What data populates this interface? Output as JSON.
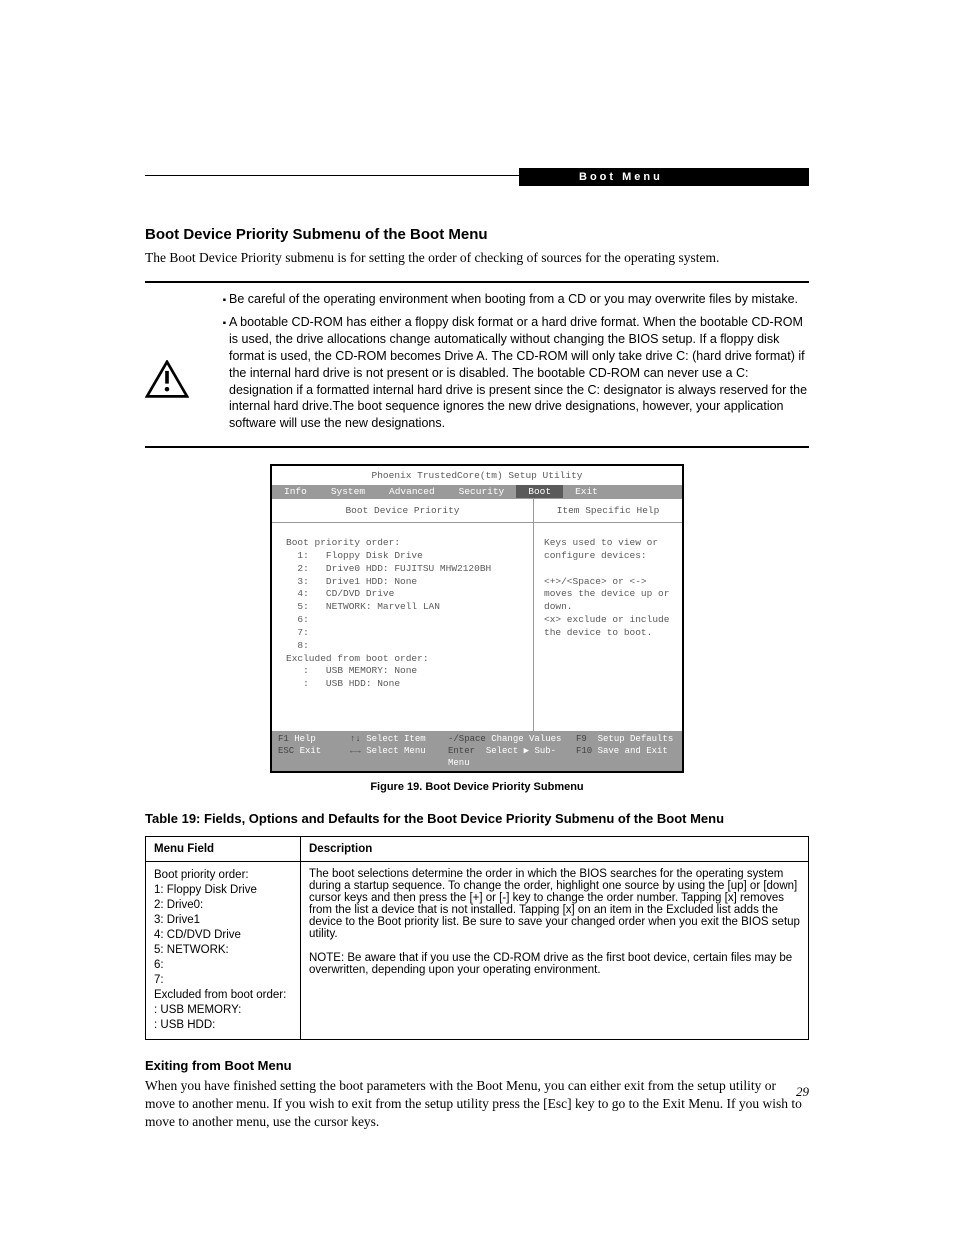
{
  "header": {
    "label": "Boot Menu"
  },
  "section": {
    "title": "Boot Device Priority Submenu of the Boot Menu",
    "intro": "The Boot Device Priority submenu is for setting the order of checking of sources for the operating system."
  },
  "warning": {
    "bullets": [
      "Be careful of the operating environment when booting from a CD or you may overwrite files by mistake.",
      "A bootable CD-ROM has either a floppy disk format or a hard drive format. When the bootable CD-ROM is used, the drive allocations change automatically without changing the BIOS setup. If a floppy disk format is used, the CD-ROM becomes Drive A. The CD-ROM will only take drive C: (hard drive format) if the internal hard drive is not present or is disabled. The bootable CD-ROM can never use a C: designation if a formatted internal hard drive is present since the C: designator is always reserved for the internal hard drive.The boot sequence ignores the new drive designations, however, your application software will use the new designations."
    ]
  },
  "bios": {
    "title": "Phoenix TrustedCore(tm) Setup Utility",
    "tabs": [
      "Info",
      "System",
      "Advanced",
      "Security",
      "Boot",
      "Exit"
    ],
    "active_tab": "Boot",
    "left_header": "Boot Device Priority",
    "right_header": "Item Specific Help",
    "priority_label": "Boot priority order:",
    "priority": [
      "1:   Floppy Disk Drive",
      "2:   Drive0 HDD: FUJITSU MHW2120BH",
      "3:   Drive1 HDD: None",
      "4:   CD/DVD Drive",
      "5:   NETWORK: Marvell LAN",
      "6:",
      "7:",
      "8:"
    ],
    "excluded_label": "Excluded from boot order:",
    "excluded": [
      " :   USB MEMORY: None",
      " :   USB HDD: None"
    ],
    "help_lines": [
      "Keys used to view or",
      "configure devices:",
      "",
      "<+>/<Space> or <->",
      "moves the device up or",
      "down.",
      "<x> exclude or include",
      "the device to boot."
    ],
    "footer": {
      "row1": {
        "c1k": "F1",
        "c1l": "Help",
        "c2k": "↑↓",
        "c2l": "Select Item",
        "c3k": "-/Space",
        "c3l": "Change Values",
        "c4k": "F9",
        "c4l": "Setup Defaults"
      },
      "row2": {
        "c1k": "ESC",
        "c1l": "Exit",
        "c2k": "←→",
        "c2l": "Select Menu",
        "c3k": "Enter",
        "c3l": "Select ▶ Sub-Menu",
        "c4k": "F10",
        "c4l": "Save and Exit"
      }
    }
  },
  "figure_caption": "Figure 19.  Boot Device Priority Submenu",
  "table": {
    "caption": "Table 19: Fields, Options and Defaults for the Boot Device Priority Submenu of the Boot Menu",
    "headers": [
      "Menu Field",
      "Description"
    ],
    "row": {
      "field_lines": [
        "Boot priority order:",
        " 1: Floppy Disk Drive",
        " 2: Drive0:",
        " 3: Drive1",
        " 4: CD/DVD Drive",
        " 5: NETWORK:",
        " 6:",
        " 7:",
        "Excluded from boot order:",
        "   : USB MEMORY:",
        "   : USB HDD:"
      ],
      "desc_p1": "The boot selections determine the order in which the BIOS searches for the operating system during a startup sequence. To change the order, highlight one source by using the [up] or [down] cursor keys and then press the [+] or [-] key to change the order number. Tapping [x] removes from the list a device that is not installed. Tapping [x] on an item in the Excluded list adds the device to the Boot priority list. Be sure to save your changed order when you exit the BIOS setup utility.",
      "desc_p2": "NOTE: Be aware that if you use the CD-ROM drive as the first boot device, certain files may be overwritten, depending upon your operating environment."
    }
  },
  "exit": {
    "title": "Exiting from Boot Menu",
    "body": "When you have finished setting the boot parameters with the Boot Menu, you can either exit from the setup utility or move to another menu. If you wish to exit from the setup utility press the [Esc] key to go to the Exit Menu. If you wish to move to another menu, use the cursor keys."
  },
  "page_number": "29"
}
